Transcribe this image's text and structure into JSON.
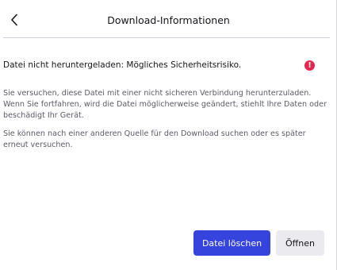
{
  "header": {
    "title": "Download-Informationen",
    "back_icon": "chevron-left-icon"
  },
  "warning": {
    "heading": "Datei nicht heruntergeladen: Mögliches Sicherheitsrisiko.",
    "icon": "error-icon",
    "icon_glyph": "!",
    "icon_color": "#e22850"
  },
  "body": {
    "paragraph1": "Sie versuchen, diese Datei mit einer nicht sicheren Verbindung herunterzuladen. Wenn Sie fortfahren, wird die Datei möglicherweise geändert, stiehlt Ihre Daten oder beschädigt Ihr Gerät.",
    "paragraph2": "Sie können nach einer anderen Quelle für den Download suchen oder es später erneut versuchen."
  },
  "actions": {
    "delete_label": "Datei löschen",
    "open_label": "Öffnen",
    "primary_color": "#3544dc"
  }
}
